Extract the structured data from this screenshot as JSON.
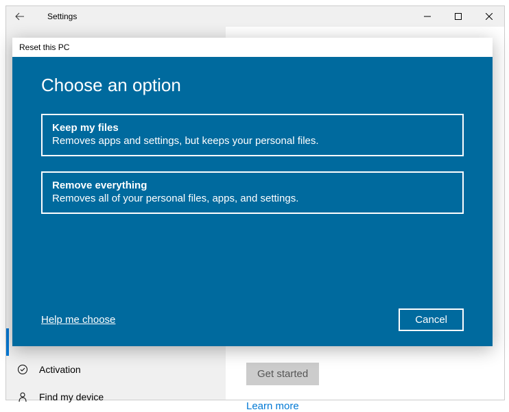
{
  "window": {
    "title": "Settings"
  },
  "sidebar": {
    "items": [
      {
        "label": "Activation"
      },
      {
        "label": "Find my device"
      }
    ]
  },
  "content": {
    "get_started": "Get started",
    "learn_more": "Learn more"
  },
  "dialog": {
    "title": "Reset this PC",
    "heading": "Choose an option",
    "options": [
      {
        "title": "Keep my files",
        "desc": "Removes apps and settings, but keeps your personal files."
      },
      {
        "title": "Remove everything",
        "desc": "Removes all of your personal files, apps, and settings."
      }
    ],
    "help_link": "Help me choose",
    "cancel": "Cancel"
  }
}
